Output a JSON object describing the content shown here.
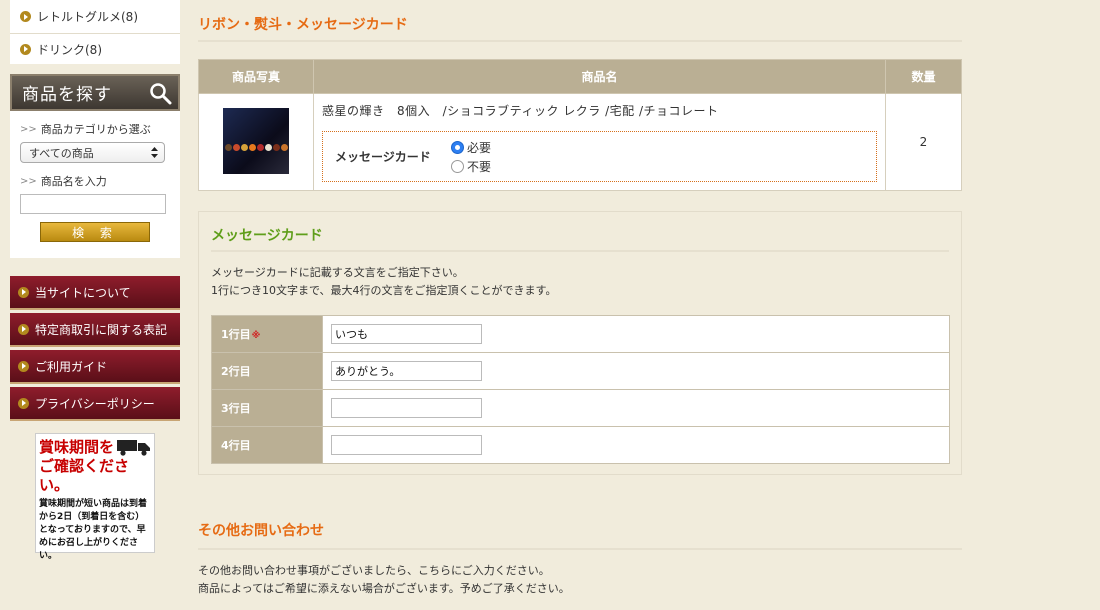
{
  "sidebar": {
    "categories": [
      {
        "label": "レトルトグルメ(8)"
      },
      {
        "label": "ドリンク(8)"
      }
    ],
    "search": {
      "title": "商品を探す",
      "category_label": "商品カテゴリから選ぶ",
      "category_selected": "すべての商品",
      "name_label": "商品名を入力",
      "name_value": "",
      "button_label": "検 索"
    },
    "nav": [
      {
        "label": "当サイトについて"
      },
      {
        "label": "特定商取引に関する表記"
      },
      {
        "label": "ご利用ガイド"
      },
      {
        "label": "プライバシーポリシー"
      }
    ],
    "notice": {
      "title_1": "賞味期間を",
      "title_2": "ご確認ください。",
      "body": "賞味期間が短い商品は到着から2日（到着日を含む）となっておりますので、早めにお召し上がりください。"
    }
  },
  "main": {
    "section_title": "リボン・熨斗・メッセージカード",
    "table": {
      "col_photo": "商品写真",
      "col_name": "商品名",
      "col_qty": "数量",
      "product_name": "惑星の輝き　8個入　/ショコラブティック レクラ /宅配 /チョコレート",
      "quantity": "2",
      "message_card_label": "メッセージカード",
      "option_required": "必要",
      "option_not_required": "不要"
    },
    "card": {
      "title": "メッセージカード",
      "desc_1": "メッセージカードに記載する文言をご指定下さい。",
      "desc_2": "1行につき10文字まで、最大4行の文言をご指定頂くことができます。",
      "required_mark": "※",
      "lines": [
        {
          "label": "1行目",
          "value": "いつも"
        },
        {
          "label": "2行目",
          "value": "ありがとう。"
        },
        {
          "label": "3行目",
          "value": ""
        },
        {
          "label": "4行目",
          "value": ""
        }
      ]
    },
    "other": {
      "title": "その他お問い合わせ",
      "desc_1": "その他お問い合わせ事項がございましたら、こちらにご入力ください。",
      "desc_2": "商品によってはご希望に添えない場合がございます。予めご了承ください。"
    }
  },
  "colors": {
    "accent_orange": "#e66b14",
    "accent_green": "#5f9e1a",
    "nav_maroon": "#8f1d2c",
    "header_tan": "#baaf94"
  }
}
